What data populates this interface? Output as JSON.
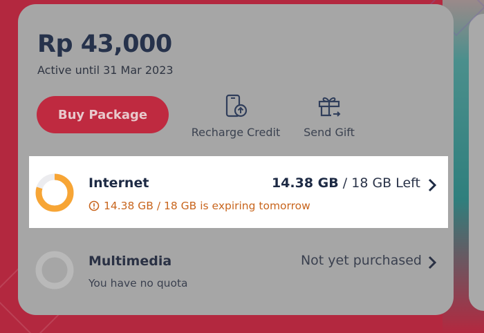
{
  "balance": {
    "amount": "Rp 43,000",
    "active_until": "Active until 31 Mar 2023"
  },
  "actions": {
    "buy_label": "Buy Package",
    "recharge_label": "Recharge Credit",
    "recharge_icon": "phone-upload-icon",
    "gift_label": "Send Gift",
    "gift_icon": "gift-icon"
  },
  "internet": {
    "title": "Internet",
    "remaining": "14.38 GB",
    "total_text": " / 18 GB Left",
    "warning": "14.38 GB / 18 GB is expiring tomorrow",
    "remaining_fraction": 0.799,
    "ring_color": "#f7a535",
    "warning_color": "#c8651d"
  },
  "multimedia": {
    "title": "Multimedia",
    "status": "Not yet purchased",
    "subtitle": "You have no quota"
  },
  "colors": {
    "accent": "#bf2a40",
    "background": "#b3283f",
    "card": "#a6a6a6",
    "text_dark": "#1d2a44"
  }
}
